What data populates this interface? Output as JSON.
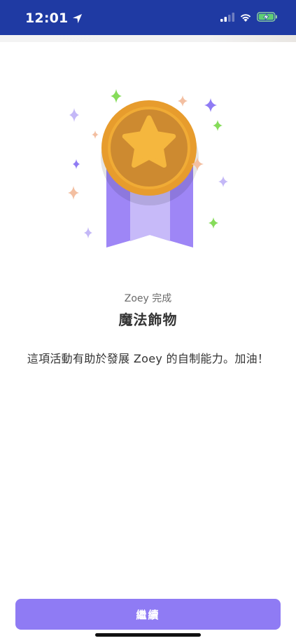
{
  "status_bar": {
    "time": "12:01",
    "icons": [
      "location-arrow-icon",
      "signal-icon",
      "wifi-icon",
      "battery-charging-icon"
    ],
    "background": "#1f3aa3"
  },
  "medal": {
    "icon": "gold-star-medal-icon",
    "ribbon_color": "#9e86f6",
    "coin_color": "#e79c2d"
  },
  "completion": {
    "completer": "Zoey 完成",
    "activity": "魔法飾物",
    "description": "這項活動有助於發展 Zoey 的自制能力。加油！"
  },
  "footer": {
    "continue_label": "繼續",
    "button_color": "#8f7bf4"
  }
}
